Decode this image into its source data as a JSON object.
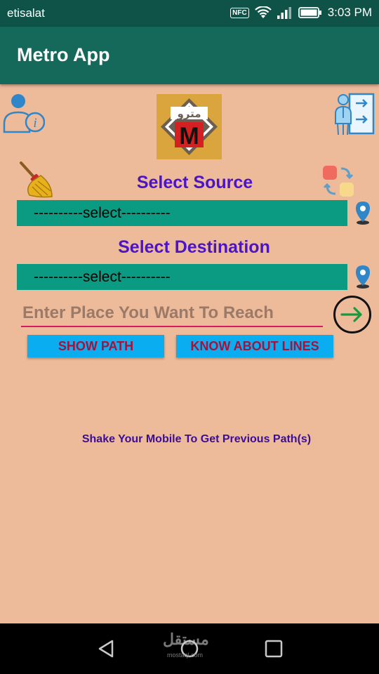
{
  "status_bar": {
    "carrier": "etisalat",
    "nfc_label": "NFC",
    "time": "3:03 PM"
  },
  "app_bar": {
    "title": "Metro App"
  },
  "logo": {
    "text": "مترو",
    "letter": "M",
    "colors": {
      "bg": "#d9a53c",
      "badge": "#d42020"
    }
  },
  "source": {
    "heading": "Select Source",
    "value": "----------select----------"
  },
  "destination": {
    "heading": "Select Destination",
    "value": "----------select----------"
  },
  "place_input": {
    "placeholder": "Enter Place You Want To Reach",
    "value": ""
  },
  "buttons": {
    "show_path": "SHOW PATH",
    "know_lines": "KNOW ABOUT LINES"
  },
  "hint": "Shake Your Mobile To Get Previous Path(s)",
  "watermark": {
    "text": "مستقل",
    "sub": "mostaql.com"
  },
  "colors": {
    "background": "#eebb9a",
    "app_bar": "#14695b",
    "status_bar": "#0f5247",
    "spinner": "#0b9b82",
    "heading": "#4b14c8",
    "button_bg": "#0aaef0",
    "button_text": "#a6123b",
    "input_underline": "#d81b60",
    "go_arrow": "#1b9a3c"
  },
  "icons": {
    "user_info": "user-info-icon",
    "logo": "metro-logo-icon",
    "directions": "directions-icon",
    "clear": "broom-icon",
    "swap": "swap-icon",
    "source_pin": "map-pin-icon",
    "destination_pin": "map-pin-icon",
    "go": "arrow-right-circle-icon",
    "nav_back": "back-triangle-icon",
    "nav_home": "home-circle-icon",
    "nav_recents": "recents-square-icon",
    "wifi": "wifi-icon",
    "signal": "signal-icon",
    "battery": "battery-icon"
  }
}
